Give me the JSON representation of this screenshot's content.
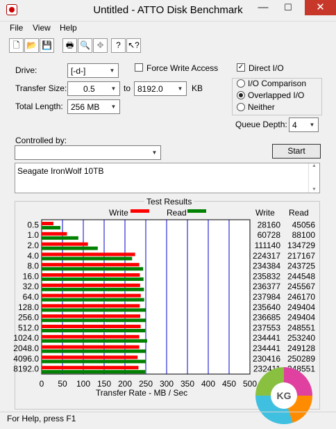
{
  "window": {
    "title": "Untitled - ATTO Disk Benchmark",
    "minimize": "—",
    "maximize": "☐",
    "close": "✕"
  },
  "menu": {
    "file": "File",
    "view": "View",
    "help": "Help"
  },
  "toolbar": {
    "icons": [
      "new-icon",
      "open-icon",
      "save-icon",
      "print-icon",
      "print-preview-icon",
      "move-icon",
      "help-icon",
      "context-help-icon"
    ]
  },
  "form": {
    "drive_label": "Drive:",
    "drive_value": "[-d-]",
    "force_write_label": "Force Write Access",
    "force_write_checked": false,
    "direct_io_label": "Direct I/O",
    "direct_io_checked": true,
    "transfer_size_label": "Transfer Size:",
    "transfer_from": "0.5",
    "to_label": "to",
    "transfer_to": "8192.0",
    "kb_label": "KB",
    "total_length_label": "Total Length:",
    "total_length_value": "256 MB",
    "io_comparison": "I/O Comparison",
    "overlapped_io": "Overlapped I/O",
    "neither": "Neither",
    "selected_mode": "overlapped_io",
    "queue_depth_label": "Queue Depth:",
    "queue_depth_value": "4",
    "controlled_by_label": "Controlled by:",
    "controlled_by_value": "",
    "start_label": "Start",
    "description": "Seagate IronWolf 10TB"
  },
  "results": {
    "group_title": "Test Results",
    "write_legend": "Write",
    "read_legend": "Read",
    "write_col": "Write",
    "read_col": "Read",
    "write_color": "#ff0000",
    "read_color": "#008000"
  },
  "chart_data": {
    "type": "bar",
    "orientation": "horizontal",
    "categories": [
      "0.5",
      "1.0",
      "2.0",
      "4.0",
      "8.0",
      "16.0",
      "32.0",
      "64.0",
      "128.0",
      "256.0",
      "512.0",
      "1024.0",
      "2048.0",
      "4096.0",
      "8192.0"
    ],
    "series": [
      {
        "name": "Write",
        "values": [
          28160,
          60728,
          111140,
          224317,
          234384,
          235832,
          236377,
          237984,
          235640,
          236685,
          237553,
          234441,
          234441,
          230416,
          232411
        ]
      },
      {
        "name": "Read",
        "values": [
          45056,
          88100,
          134729,
          217167,
          243725,
          244548,
          245567,
          246170,
          249404,
          249404,
          248551,
          253240,
          249128,
          250289,
          248551
        ]
      }
    ],
    "xlabel": "Transfer Rate - MB / Sec",
    "xticks": [
      "0",
      "50",
      "100",
      "150",
      "200",
      "250",
      "300",
      "350",
      "400",
      "450",
      "500"
    ],
    "xlim": [
      0,
      500
    ],
    "value_unit_divisor": 1000,
    "grid": true
  },
  "status": {
    "text": "For Help, press F1"
  },
  "watermark": {
    "text": "KG"
  }
}
